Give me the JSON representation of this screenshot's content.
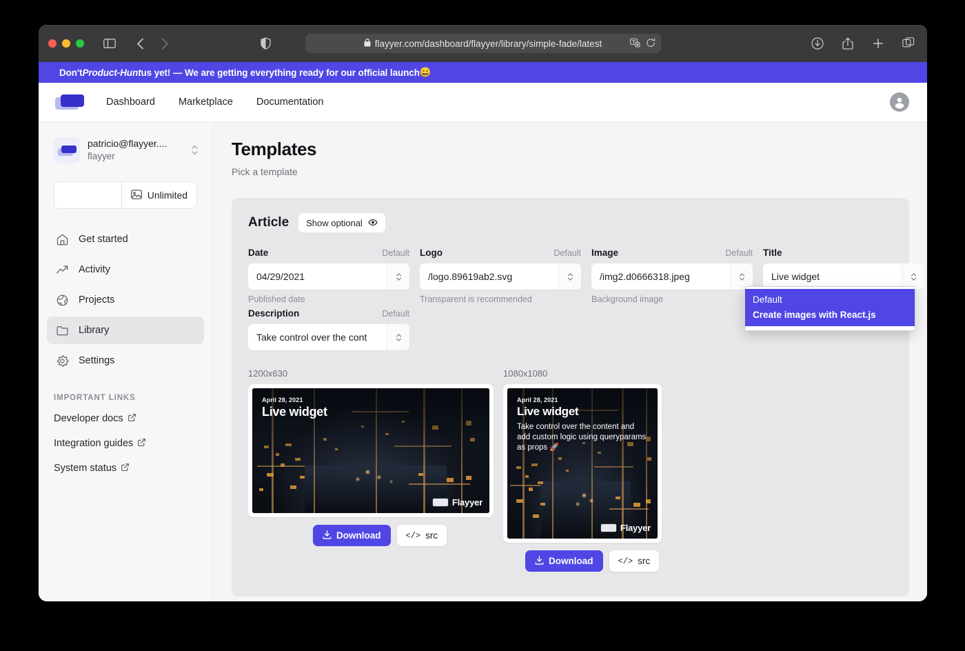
{
  "browser": {
    "url": "flayyer.com/dashboard/flayyer/library/simple-fade/latest",
    "lock_icon": "lock-icon",
    "back_icon": "back-chevron-icon",
    "forward_icon": "forward-chevron-icon",
    "sidebar_icon": "sidebar-toggle-icon",
    "shield_icon": "privacy-shield-icon",
    "translate_icon": "translate-icon",
    "reload_icon": "reload-icon",
    "downloads_icon": "downloads-icon",
    "share_icon": "share-icon",
    "newtab_icon": "new-tab-icon",
    "tabs_icon": "tab-overview-icon"
  },
  "announcement": {
    "text_before": "Don't ",
    "text_em": "Product-Hunt",
    "text_after": " us yet! — We are getting everything ready for our official launch ",
    "emoji": "😄",
    "background": "#4f46e5"
  },
  "topnav": {
    "logo_name": "flayyer-logo",
    "links": [
      {
        "label": "Dashboard"
      },
      {
        "label": "Marketplace"
      },
      {
        "label": "Documentation"
      }
    ],
    "avatar_icon": "user-avatar-icon"
  },
  "sidebar": {
    "account": {
      "email": "patricio@flayyer....",
      "org": "flayyer",
      "switch_icon": "chevron-up-down-icon"
    },
    "quota": {
      "icon": "image-icon",
      "label": "Unlimited"
    },
    "items": [
      {
        "label": "Get started",
        "icon": "home-icon",
        "active": false
      },
      {
        "label": "Activity",
        "icon": "trending-up-icon",
        "active": false
      },
      {
        "label": "Projects",
        "icon": "globe-icon",
        "active": false
      },
      {
        "label": "Library",
        "icon": "folder-icon",
        "active": true
      },
      {
        "label": "Settings",
        "icon": "gear-icon",
        "active": false
      }
    ],
    "links_heading": "IMPORTANT LINKS",
    "links": [
      {
        "label": "Developer docs",
        "icon": "external-link-icon"
      },
      {
        "label": "Integration guides",
        "icon": "external-link-icon"
      },
      {
        "label": "System status",
        "icon": "external-link-icon"
      }
    ]
  },
  "main": {
    "title": "Templates",
    "subtitle": "Pick a template",
    "panel": {
      "title": "Article",
      "show_optional_label": "Show optional",
      "show_optional_icon": "eye-icon",
      "fields": [
        {
          "label": "Date",
          "badge": "Default",
          "value": "04/29/2021",
          "hint": "Published date",
          "name": "date-field"
        },
        {
          "label": "Logo",
          "badge": "Default",
          "value": "/logo.89619ab2.svg",
          "hint": "Transparent is recommended",
          "name": "logo-field"
        },
        {
          "label": "Image",
          "badge": "Default",
          "value": "/img2.d0666318.jpeg",
          "hint": "Background image",
          "name": "image-field"
        },
        {
          "label": "Title",
          "badge": "",
          "value": "Live widget",
          "hint": "",
          "name": "title-field"
        },
        {
          "label": "Description",
          "badge": "Default",
          "value": "Take control over the cont",
          "hint": "",
          "name": "description-field"
        }
      ],
      "dropdown": {
        "options": [
          {
            "label": "Default",
            "bold": false
          },
          {
            "label": "Create images with React.js",
            "bold": true
          }
        ],
        "highlight_color": "#4f46e5"
      }
    },
    "previews": [
      {
        "size_label": "1200x630",
        "date": "April 28, 2021",
        "title": "Live widget",
        "description": "",
        "watermark": "Flayyer",
        "download_label": "Download",
        "download_icon": "download-icon",
        "src_label": "src",
        "src_icon": "code-icon"
      },
      {
        "size_label": "1080x1080",
        "date": "April 28, 2021",
        "title": "Live widget",
        "description": "Take control over the content and add custom logic using queryparams as props 🚀",
        "watermark": "Flayyer",
        "download_label": "Download",
        "download_icon": "download-icon",
        "src_label": "src",
        "src_icon": "code-icon"
      }
    ]
  }
}
